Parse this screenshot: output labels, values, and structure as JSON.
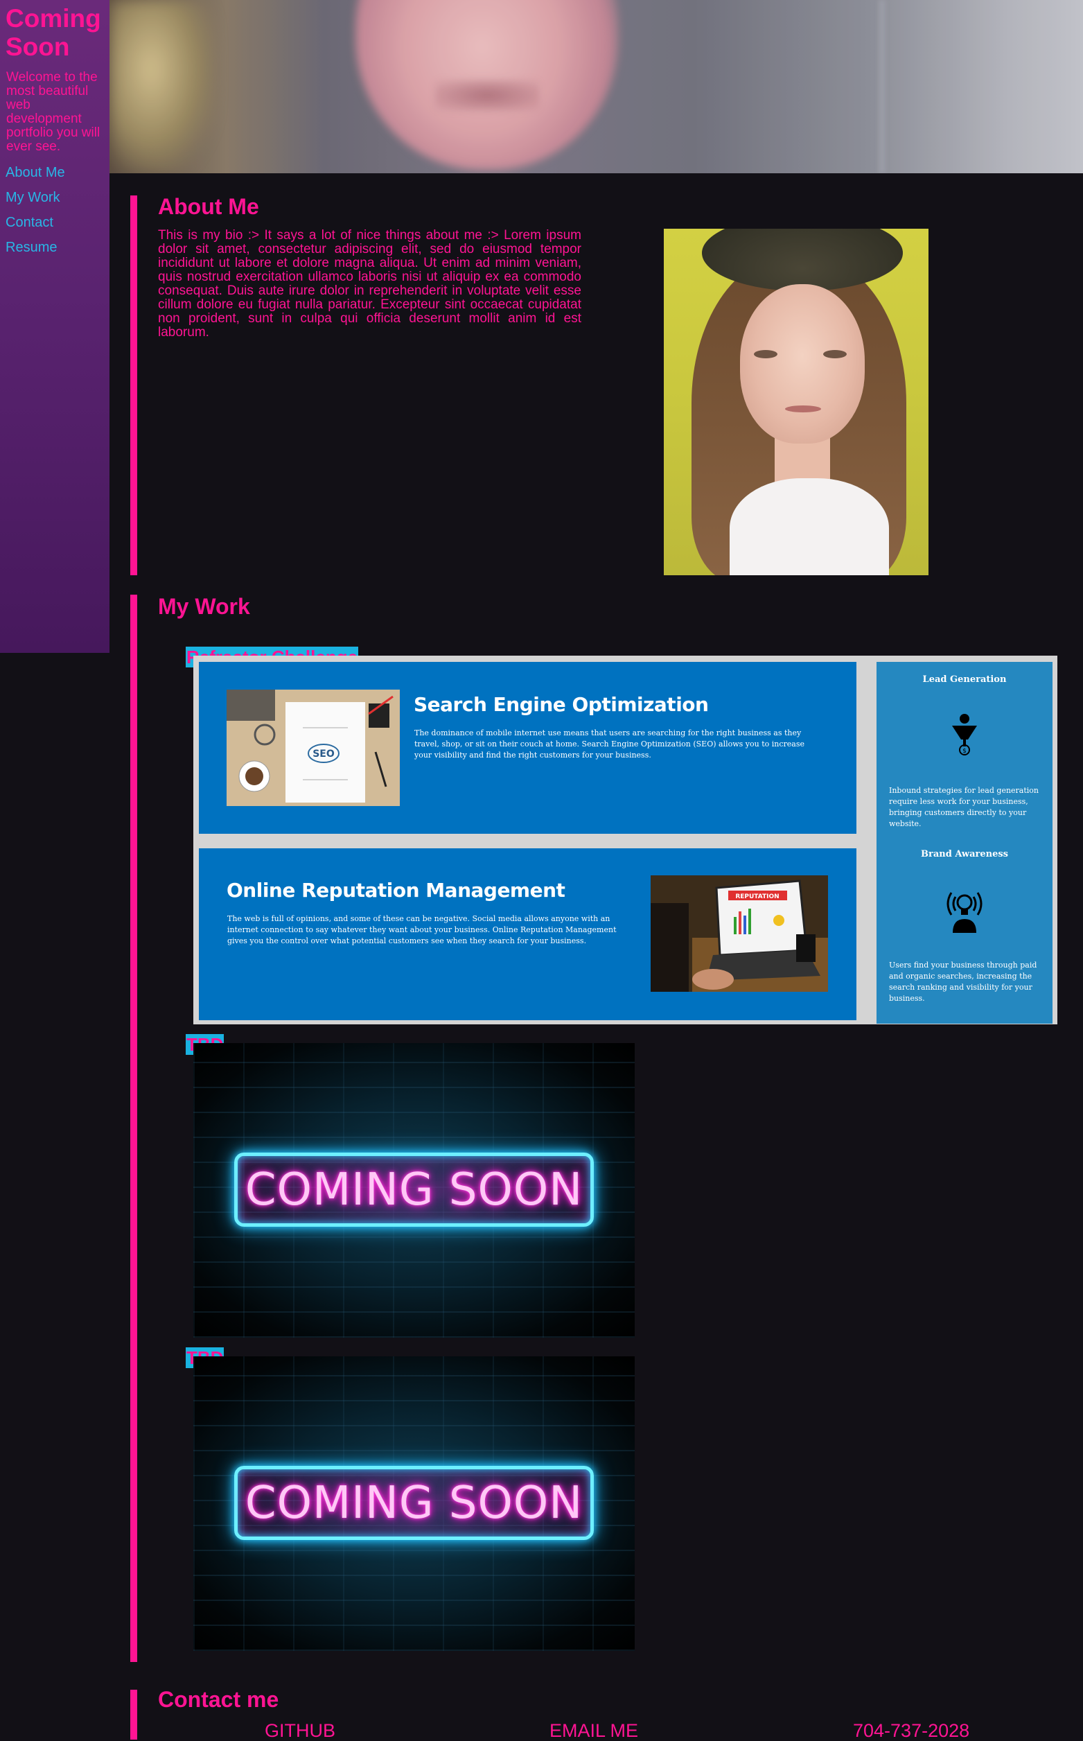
{
  "sidebar": {
    "title": "Coming Soon",
    "tagline": "Welcome to the most beautiful web development portfolio you will ever see.",
    "nav": [
      {
        "label": "About Me"
      },
      {
        "label": "My Work"
      },
      {
        "label": "Contact"
      },
      {
        "label": "Resume"
      }
    ]
  },
  "about": {
    "heading": "About Me",
    "bio": "This is my bio :> It says a lot of nice things about me :> Lorem ipsum dolor sit amet, consectetur adipiscing elit, sed do eiusmod tempor incididunt ut labore et dolore magna aliqua. Ut enim ad minim veniam, quis nostrud exercitation ullamco laboris nisi ut aliquip ex ea commodo consequat. Duis aute irure dolor in reprehenderit in voluptate velit esse cillum dolore eu fugiat nulla pariatur. Excepteur sint occaecat cupidatat non proident, sunt in culpa qui officia deserunt mollit anim id est laborum."
  },
  "work": {
    "heading": "My Work",
    "projects": [
      {
        "label": "Refractor Challenge",
        "seo": {
          "title": "Search Engine Optimization",
          "text": "The dominance of mobile internet use means that users are searching for the right business as they travel, shop, or sit on their couch at home. Search Engine Optimization (SEO) allows you to increase your visibility and find the right customers for your business.",
          "image_text": "SEO"
        },
        "orm": {
          "title": "Online Reputation Management",
          "text": "The web is full of opinions, and some of these can be negative. Social media allows anyone with an internet connection to say whatever they want about your business. Online Reputation Management gives you the control over what potential customers see when they search for your business.",
          "image_text": "REPUTATION"
        },
        "side": {
          "lead_heading": "Lead Generation",
          "lead_text": "Inbound strategies for lead generation require less work for your business, bringing customers directly to your website.",
          "brand_heading": "Brand Awareness",
          "brand_text": "Users find your business through paid and organic searches, increasing the search ranking and visibility for your business."
        }
      },
      {
        "label": "TBD",
        "image_text": "COMING SOON"
      },
      {
        "label": "TBD",
        "image_text": "COMING SOON"
      }
    ]
  },
  "contact": {
    "heading": "Contact me",
    "links": [
      {
        "label": "GITHUB"
      },
      {
        "label": "EMAIL ME"
      },
      {
        "label": "704-737-2028"
      }
    ]
  },
  "colors": {
    "accent": "#ff1493",
    "link": "#29b6e6",
    "background": "#121016",
    "sidebar": "#5a2370",
    "card_blue": "#0072c0"
  }
}
